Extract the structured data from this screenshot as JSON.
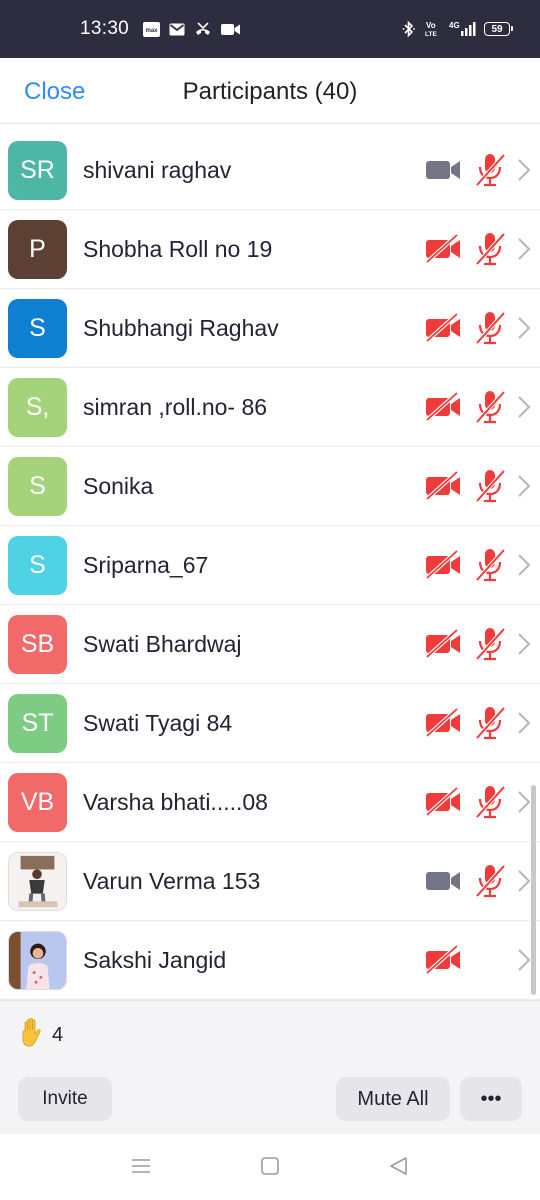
{
  "status_bar": {
    "time": "13:30",
    "left_icons": [
      "max-app-icon",
      "gmail-icon",
      "missed-call-icon",
      "video-camera-icon"
    ],
    "right_icons": [
      "bluetooth-icon",
      "volte-icon",
      "4g-signal-icon",
      "battery-icon"
    ],
    "volte_text": "Vo LTE",
    "network_text": "4G",
    "battery_level": "59"
  },
  "header": {
    "close_label": "Close",
    "title": "Participants (40)"
  },
  "participants": [
    {
      "initials": "SR",
      "name": "shivani raghav",
      "avatar_color": "#4db6a4",
      "video_on": true,
      "muted": true
    },
    {
      "initials": "P",
      "name": "Shobha Roll no 19",
      "avatar_color": "#5c4033",
      "video_on": false,
      "muted": true
    },
    {
      "initials": "S",
      "name": "Shubhangi Raghav",
      "avatar_color": "#0e7fd1",
      "video_on": false,
      "muted": true
    },
    {
      "initials": "S,",
      "name": "simran ,roll.no- 86",
      "avatar_color": "#a5d37c",
      "video_on": false,
      "muted": true
    },
    {
      "initials": "S",
      "name": "Sonika",
      "avatar_color": "#a5d37c",
      "video_on": false,
      "muted": true
    },
    {
      "initials": "S",
      "name": "Sriparna_67",
      "avatar_color": "#4fd3e4",
      "video_on": false,
      "muted": true
    },
    {
      "initials": "SB",
      "name": "Swati Bhardwaj",
      "avatar_color": "#f26969",
      "video_on": false,
      "muted": true
    },
    {
      "initials": "ST",
      "name": "Swati Tyagi 84",
      "avatar_color": "#7ecb83",
      "video_on": false,
      "muted": true
    },
    {
      "initials": "VB",
      "name": "Varsha bhati.....08",
      "avatar_color": "#f26969",
      "video_on": false,
      "muted": true
    },
    {
      "initials": "",
      "name": "Varun Verma 153",
      "avatar_color": "#f3f3f3",
      "video_on": true,
      "muted": true,
      "photo": true
    },
    {
      "initials": "",
      "name": "Sakshi Jangid",
      "avatar_color": "#cfd8f2",
      "video_on": false,
      "muted": null,
      "photo": true
    }
  ],
  "footer": {
    "raised_hands_icon": "raised-hand-icon",
    "raised_hands_count": "4",
    "invite_label": "Invite",
    "mute_all_label": "Mute All",
    "more_label": "•••"
  },
  "colors": {
    "accent": "#2d8cff",
    "muted_red": "#f03b3b",
    "camera_gray": "#747487",
    "status_bar_bg": "#2d2d3f"
  },
  "nav_bar": {
    "icons": [
      "menu-icon",
      "home-icon",
      "back-icon"
    ]
  }
}
